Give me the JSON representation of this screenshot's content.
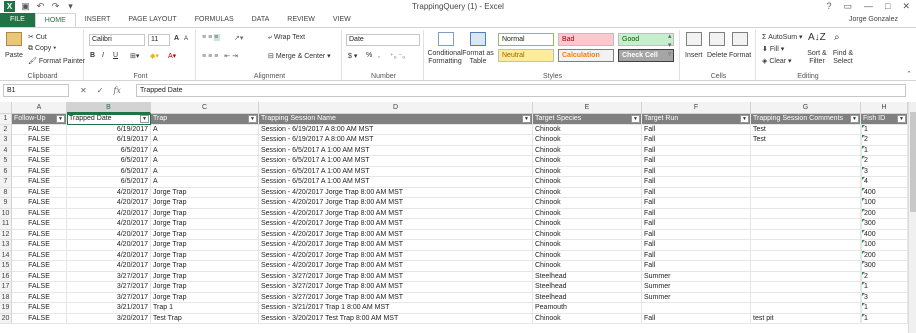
{
  "window": {
    "title": "TrappingQuery (1) - Excel",
    "user": "Jorge Gonzalez",
    "controls": [
      "?",
      "▭",
      "—",
      "□",
      "✕"
    ]
  },
  "tabs": [
    "FILE",
    "HOME",
    "INSERT",
    "PAGE LAYOUT",
    "FORMULAS",
    "DATA",
    "REVIEW",
    "VIEW"
  ],
  "ribbon": {
    "clipboard": {
      "paste": "Paste",
      "cut": "Cut",
      "copy": "Copy",
      "format_painter": "Format Painter",
      "label": "Clipboard"
    },
    "font": {
      "name": "Calibri",
      "size": "11",
      "bold": "B",
      "italic": "I",
      "underline": "U",
      "grow": "A",
      "shrink": "A",
      "label": "Font"
    },
    "alignment": {
      "wrap": "Wrap Text",
      "merge": "Merge & Center",
      "label": "Alignment"
    },
    "number": {
      "format": "Date",
      "currency": "$",
      "percent": "%",
      "comma": ",",
      "label": "Number"
    },
    "styles": {
      "conditional": "Conditional Formatting",
      "format_table": "Format as Table",
      "cells": [
        {
          "name": "Normal",
          "bg": "#ffffff",
          "fg": "#222222",
          "border": "#9bbb59"
        },
        {
          "name": "Bad",
          "bg": "#ffc7ce",
          "fg": "#9c0006",
          "border": "#bfbfbf"
        },
        {
          "name": "Good",
          "bg": "#c6efce",
          "fg": "#006100",
          "border": "#bfbfbf"
        },
        {
          "name": "Neutral",
          "bg": "#ffeb9c",
          "fg": "#9c6500",
          "border": "#bfbfbf"
        },
        {
          "name": "Calculation",
          "bg": "#f2f2f2",
          "fg": "#fa7d00",
          "border": "#7f7f7f"
        },
        {
          "name": "Check Cell",
          "bg": "#a5a5a5",
          "fg": "#ffffff",
          "border": "#3f3f3f"
        }
      ],
      "label": "Styles"
    },
    "cells": {
      "insert": "Insert",
      "delete": "Delete",
      "format": "Format",
      "label": "Cells"
    },
    "editing": {
      "autosum": "AutoSum",
      "fill": "Fill",
      "clear": "Clear",
      "sort": "Sort & Filter",
      "find": "Find & Select",
      "label": "Editing"
    }
  },
  "formula_bar": {
    "name_box": "B1",
    "value": "Trapped Date"
  },
  "columns": [
    "A",
    "B",
    "C",
    "D",
    "E",
    "F",
    "G",
    "H"
  ],
  "headers": [
    "Follow-Up",
    "Trapped Date",
    "Trap",
    "Trapping Session Name",
    "Target Species",
    "Target Run",
    "Trapping Session Comments",
    "Fish ID"
  ],
  "rows": [
    [
      "FALSE",
      "6/19/2017",
      "A",
      "Session - 6/19/2017 A 8:00 AM MST",
      "Chinook",
      "Fall",
      "Test",
      "1"
    ],
    [
      "FALSE",
      "6/19/2017",
      "A",
      "Session - 6/19/2017 A 8:00 AM MST",
      "Chinook",
      "Fall",
      "Test",
      "2"
    ],
    [
      "FALSE",
      "6/5/2017",
      "A",
      "Session - 6/5/2017 A 1:00 AM MST",
      "Chinook",
      "Fall",
      "",
      "1"
    ],
    [
      "FALSE",
      "6/5/2017",
      "A",
      "Session - 6/5/2017 A 1:00 AM MST",
      "Chinook",
      "Fall",
      "",
      "2"
    ],
    [
      "FALSE",
      "6/5/2017",
      "A",
      "Session - 6/5/2017 A 1:00 AM MST",
      "Chinook",
      "Fall",
      "",
      "3"
    ],
    [
      "FALSE",
      "6/5/2017",
      "A",
      "Session - 6/5/2017 A 1:00 AM MST",
      "Chinook",
      "Fall",
      "",
      "4"
    ],
    [
      "FALSE",
      "4/20/2017",
      "Jorge Trap",
      "Session - 4/20/2017 Jorge Trap 8:00 AM MST",
      "Chinook",
      "Fall",
      "",
      "400"
    ],
    [
      "FALSE",
      "4/20/2017",
      "Jorge Trap",
      "Session - 4/20/2017 Jorge Trap 8:00 AM MST",
      "Chinook",
      "Fall",
      "",
      "100"
    ],
    [
      "FALSE",
      "4/20/2017",
      "Jorge Trap",
      "Session - 4/20/2017 Jorge Trap 8:00 AM MST",
      "Chinook",
      "Fall",
      "",
      "200"
    ],
    [
      "FALSE",
      "4/20/2017",
      "Jorge Trap",
      "Session - 4/20/2017 Jorge Trap 8:00 AM MST",
      "Chinook",
      "Fall",
      "",
      "300"
    ],
    [
      "FALSE",
      "4/20/2017",
      "Jorge Trap",
      "Session - 4/20/2017 Jorge Trap 8:00 AM MST",
      "Chinook",
      "Fall",
      "",
      "400"
    ],
    [
      "FALSE",
      "4/20/2017",
      "Jorge Trap",
      "Session - 4/20/2017 Jorge Trap 8:00 AM MST",
      "Chinook",
      "Fall",
      "",
      "100"
    ],
    [
      "FALSE",
      "4/20/2017",
      "Jorge Trap",
      "Session - 4/20/2017 Jorge Trap 8:00 AM MST",
      "Chinook",
      "Fall",
      "",
      "200"
    ],
    [
      "FALSE",
      "4/20/2017",
      "Jorge Trap",
      "Session - 4/20/2017 Jorge Trap 8:00 AM MST",
      "Chinook",
      "Fall",
      "",
      "300"
    ],
    [
      "FALSE",
      "3/27/2017",
      "Jorge Trap",
      "Session - 3/27/2017 Jorge Trap 8:00 AM MST",
      "Steelhead",
      "Summer",
      "",
      "2"
    ],
    [
      "FALSE",
      "3/27/2017",
      "Jorge Trap",
      "Session - 3/27/2017 Jorge Trap 8:00 AM MST",
      "Steelhead",
      "Summer",
      "",
      "1"
    ],
    [
      "FALSE",
      "3/27/2017",
      "Jorge Trap",
      "Session - 3/27/2017 Jorge Trap 8:00 AM MST",
      "Steelhead",
      "Summer",
      "",
      "3"
    ],
    [
      "FALSE",
      "3/21/2017",
      "Trap 1",
      "Session - 3/21/2017 Trap 1 8:00 AM MST",
      "Peamouth",
      "",
      "",
      "1"
    ],
    [
      "FALSE",
      "3/20/2017",
      "Test Trap",
      "Session - 3/20/2017 Test Trap 8:00 AM MST",
      "Chinook",
      "Fall",
      "test pit",
      "1"
    ]
  ],
  "colors": {
    "excel_green": "#217346",
    "header_fill": "#808080"
  }
}
